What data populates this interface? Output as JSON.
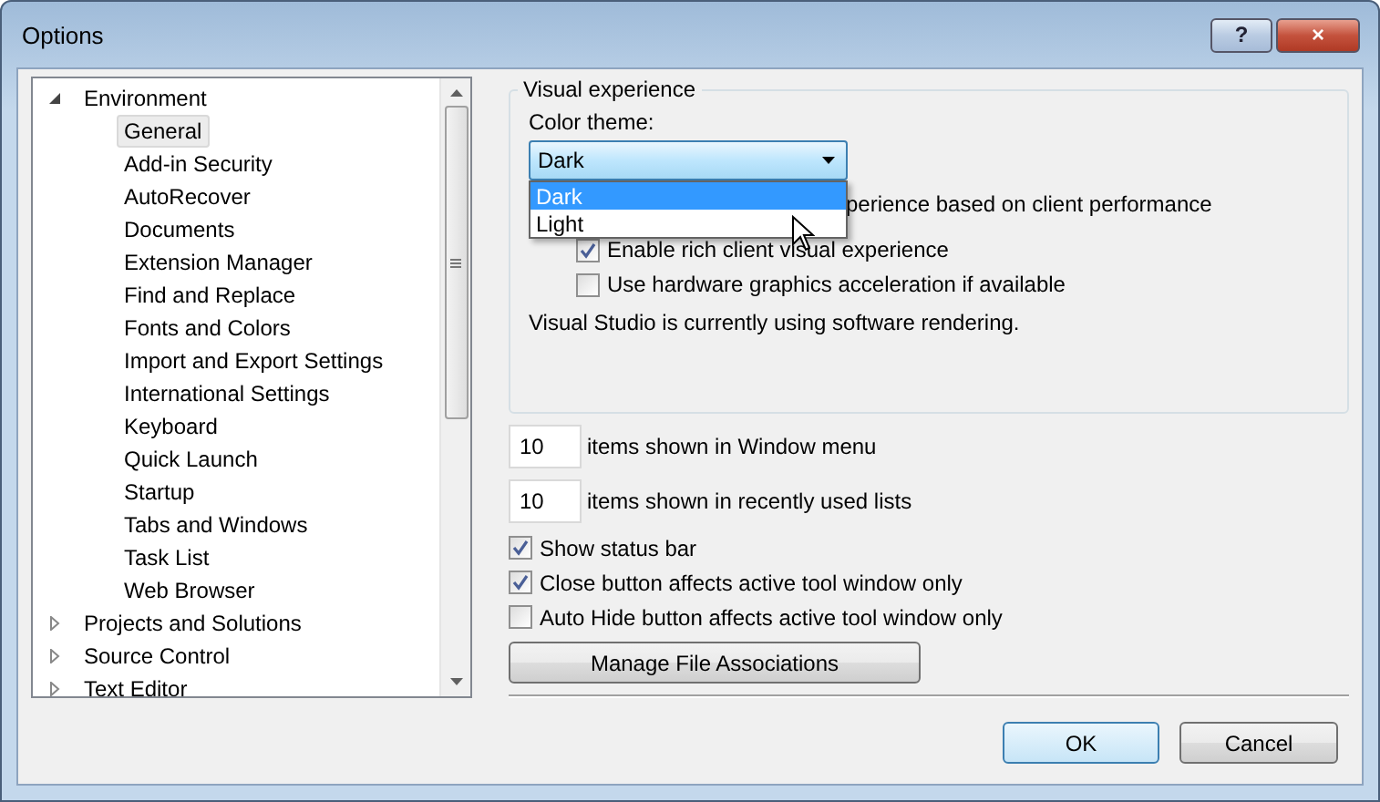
{
  "window": {
    "title": "Options",
    "buttons": [
      "?",
      "×"
    ]
  },
  "tree": [
    {
      "label": "Environment",
      "expanded": true,
      "selected": false,
      "children": [
        {
          "label": "General",
          "selected": true
        },
        {
          "label": "Add-in Security",
          "selected": false
        },
        {
          "label": "AutoRecover",
          "selected": false
        },
        {
          "label": "Documents",
          "selected": false
        },
        {
          "label": "Extension Manager",
          "selected": false
        },
        {
          "label": "Find and Replace",
          "selected": false
        },
        {
          "label": "Fonts and Colors",
          "selected": false
        },
        {
          "label": "Import and Export Settings",
          "selected": false
        },
        {
          "label": "International Settings",
          "selected": false
        },
        {
          "label": "Keyboard",
          "selected": false
        },
        {
          "label": "Quick Launch",
          "selected": false
        },
        {
          "label": "Startup",
          "selected": false
        },
        {
          "label": "Tabs and Windows",
          "selected": false
        },
        {
          "label": "Task List",
          "selected": false
        },
        {
          "label": "Web Browser",
          "selected": false
        }
      ]
    },
    {
      "label": "Projects and Solutions",
      "expanded": false,
      "selected": false
    },
    {
      "label": "Source Control",
      "expanded": false,
      "selected": false
    },
    {
      "label": "Text Editor",
      "expanded": false,
      "selected": false
    }
  ],
  "visual_experience": {
    "title": "Visual experience",
    "color_theme_label": "Color theme:",
    "color_theme_value": "Dark",
    "dropdown_options": [
      {
        "label": "Dark",
        "selected": true
      },
      {
        "label": "Light",
        "selected": false
      }
    ],
    "partial_text": "perience based on client performance",
    "checkboxes": [
      {
        "label": "Enable rich client visual experience",
        "checked": true
      },
      {
        "label": "Use hardware graphics acceleration if available",
        "checked": false
      }
    ],
    "message": "Visual Studio is currently using software rendering."
  },
  "counts": [
    {
      "value": "10",
      "label": "items shown in Window menu"
    },
    {
      "value": "10",
      "label": "items shown in recently used lists"
    }
  ],
  "checkboxes": [
    {
      "label": "Show status bar",
      "checked": true
    },
    {
      "label": "Close button affects active tool window only",
      "checked": true
    },
    {
      "label": "Auto Hide button affects active tool window only",
      "checked": false
    }
  ],
  "manage_button": "Manage File Associations",
  "buttons": [
    "OK",
    "Cancel"
  ]
}
